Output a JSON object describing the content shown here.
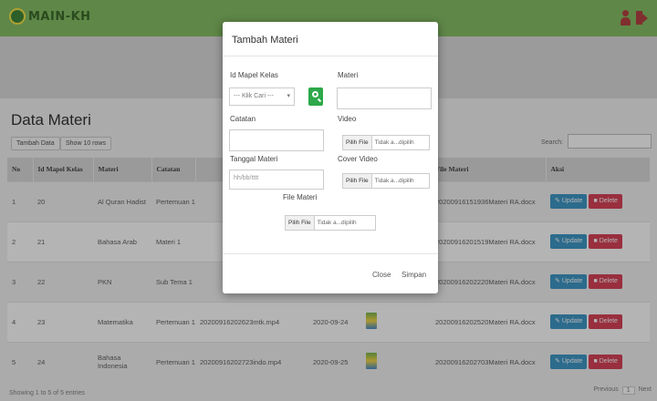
{
  "app": {
    "logo_text": "MAIN-KH"
  },
  "page": {
    "title": "Data Materi",
    "add_button": "Tambah Data",
    "show_rows": "Show 10 rows",
    "search_label": "Search:"
  },
  "table": {
    "headers": [
      "No",
      "Id Mapel Kelas",
      "Materi",
      "Catatan",
      "",
      "",
      "",
      "File Materi",
      "Aksi"
    ],
    "rows": [
      {
        "no": "1",
        "id": "20",
        "materi": "Al Quran Hadist",
        "catatan": "Pertemuan 1",
        "video": "",
        "date": "",
        "file": "20200916151936Materi RA.docx"
      },
      {
        "no": "2",
        "id": "21",
        "materi": "Bahasa Arab",
        "catatan": "Materi 1",
        "video": "",
        "date": "",
        "file": "20200916201519Materi RA.docx"
      },
      {
        "no": "3",
        "id": "22",
        "materi": "PKN",
        "catatan": "Sub Tema 1",
        "video": "",
        "date": "",
        "file": "20200916202220Materi RA.docx"
      },
      {
        "no": "4",
        "id": "23",
        "materi": "Matematika",
        "catatan": "Pertemuan 1",
        "video": "20200916202623mtk.mp4",
        "date": "2020-09-24",
        "file": "20200916202520Materi RA.docx"
      },
      {
        "no": "5",
        "id": "24",
        "materi": "Bahasa Indonesia",
        "catatan": "Pertemuan 1",
        "video": "20200916202723indo.mp4",
        "date": "2020-09-25",
        "file": "20200916202703Materi RA.docx"
      }
    ],
    "update_label": "Update",
    "delete_label": "Delete"
  },
  "footer": {
    "showing": "Showing 1 to 5 of 5 entries",
    "previous": "Previous",
    "page": "1",
    "next": "Next"
  },
  "modal": {
    "title": "Tambah Materi",
    "id_mapel_label": "Id Mapel Kelas",
    "select_value": "--- Klik Cari ---",
    "materi_label": "Materi",
    "catatan_label": "Catatan",
    "video_label": "Video",
    "tanggal_label": "Tanggal Materi",
    "tanggal_placeholder": "hh/bb/tttt",
    "cover_label": "Cover Video",
    "file_label": "File Materi",
    "choose_file": "Pilih File",
    "no_file": "Tidak a...dipilih",
    "close": "Close",
    "save": "Simpan"
  },
  "colors": {
    "topbar": "#7dbb5a",
    "update": "#2e8fc2",
    "delete": "#d6334a",
    "search_btn": "#2ea84a"
  }
}
